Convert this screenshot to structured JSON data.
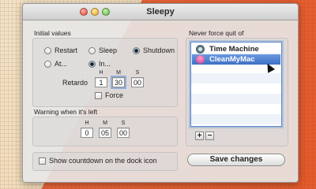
{
  "window": {
    "title": "Sleepy"
  },
  "initial_values": {
    "label": "Initial values",
    "restart_label": "Restart",
    "sleep_label": "Sleep",
    "shutdown_label": "Shutdown",
    "at_label": "At...",
    "in_label": "In...",
    "retardo_label": "Retardo",
    "h_label": "H",
    "m_label": "M",
    "s_label": "S",
    "h_value": "1",
    "m_value": "30",
    "s_value": "00",
    "force_label": "Force",
    "selected_action": "Shutdown",
    "selected_timing": "In..."
  },
  "warning": {
    "label": "Warning when it's left",
    "h_label": "H",
    "m_label": "M",
    "s_label": "S",
    "h_value": "0",
    "m_value": "05",
    "s_value": "00"
  },
  "countdown": {
    "label": "Show countdown on the dock icon",
    "checked": false
  },
  "never_force": {
    "label": "Never force quit of",
    "apps": [
      {
        "name": "Time Machine",
        "icon": "time-machine-icon",
        "selected": false
      },
      {
        "name": "CleanMyMac",
        "icon": "cleanmymac-icon",
        "selected": true
      }
    ],
    "add_label": "+",
    "remove_label": "−"
  },
  "save_label": "Save changes",
  "colors": {
    "selection": "#3d70c4",
    "accent_bg": "#e35a2c"
  }
}
